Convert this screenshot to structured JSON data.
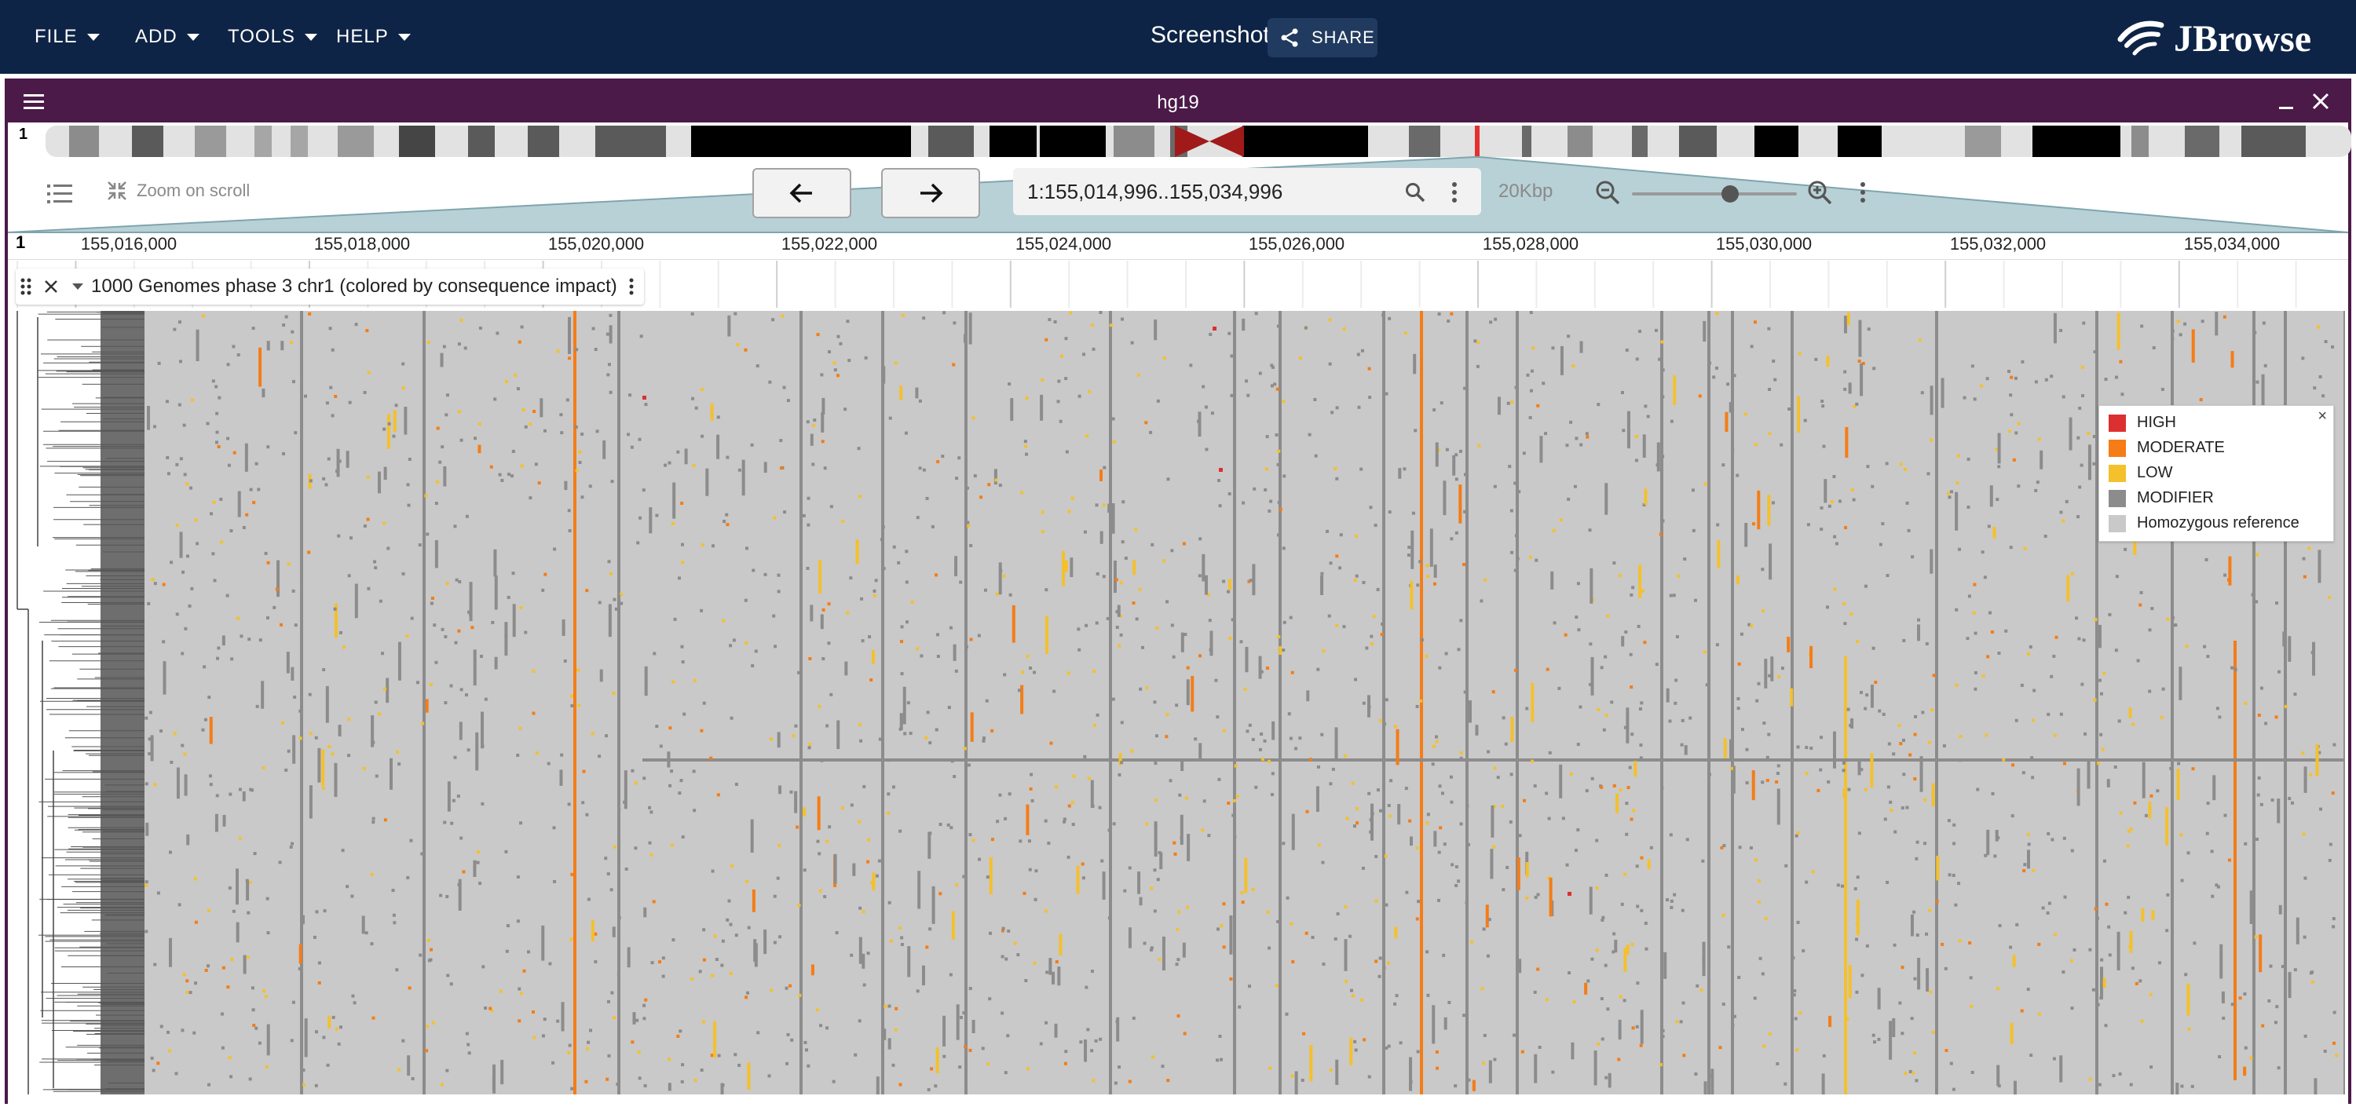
{
  "appbar": {
    "menus": [
      "FILE",
      "ADD",
      "TOOLS",
      "HELP"
    ],
    "session_title": "Screenshot",
    "share_label": "SHARE",
    "logo_text": "JBrowse",
    "background": "#0e2446"
  },
  "view": {
    "title": "hg19",
    "chromosome": "1",
    "zoom_on_scroll_label": "Zoom on scroll",
    "locstring": "1:155,014,996..155,034,996",
    "bp_width": "20Kbp",
    "header_color": "#4b1a49"
  },
  "ruler": {
    "chromosome": "1",
    "ticks": [
      "155,016,000",
      "155,018,000",
      "155,020,000",
      "155,022,000",
      "155,024,000",
      "155,026,000",
      "155,028,000",
      "155,030,000",
      "155,032,000",
      "155,034,000"
    ]
  },
  "track": {
    "name": "1000 Genomes phase 3 chr1 (colored by consequence impact)"
  },
  "legend": {
    "close": "×",
    "items": [
      {
        "label": "HIGH",
        "color": "#dc3030"
      },
      {
        "label": "MODERATE",
        "color": "#f57c16"
      },
      {
        "label": "LOW",
        "color": "#f4c02c"
      },
      {
        "label": "MODIFIER",
        "color": "#8c8c8c"
      },
      {
        "label": "Homozygous reference",
        "color": "#c9c9c9"
      }
    ]
  }
}
